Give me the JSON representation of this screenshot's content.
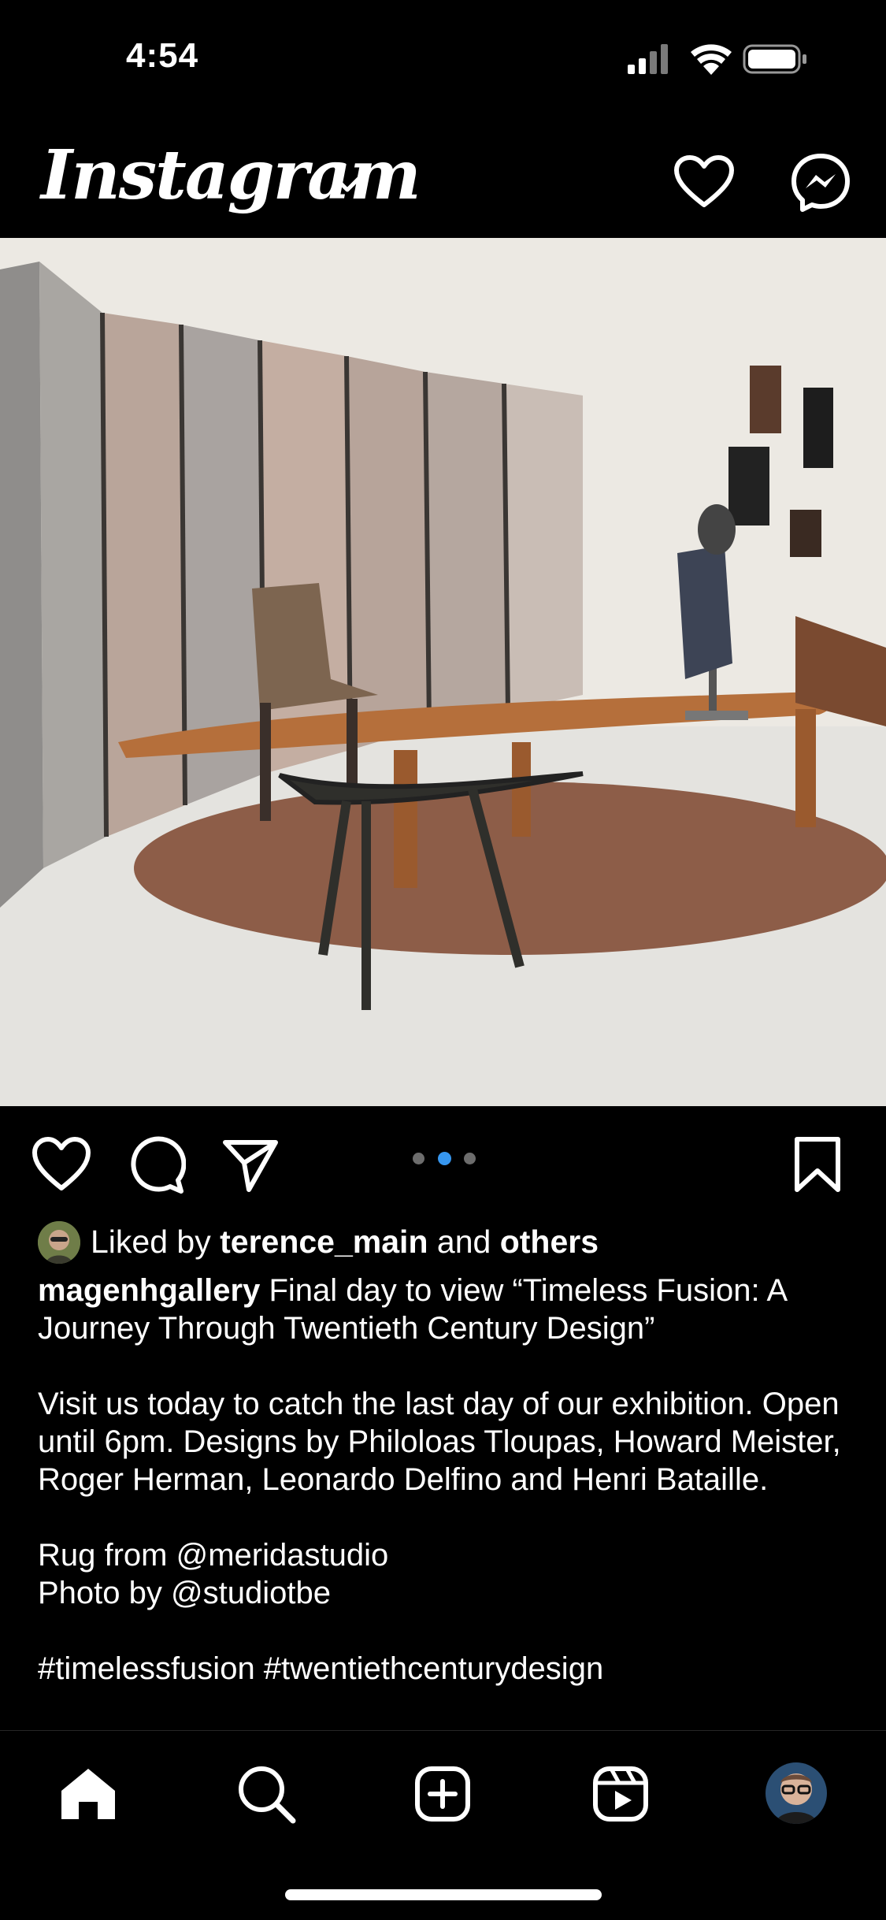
{
  "status_bar": {
    "time": "4:54"
  },
  "header": {
    "logo_text": "Instagram"
  },
  "post": {
    "image_alt": "Exhibition room with metal folding screen, wooden table, fur chair, stool and rug",
    "carousel": {
      "count": 3,
      "active_index": 1
    },
    "likes": {
      "prefix": "Liked by",
      "user": "terence_main",
      "connector": "and",
      "others": "others"
    },
    "caption": {
      "username": "magenhgallery",
      "text": " Final day to view “Timeless Fusion: A Journey Through Twentieth Century Design”\n\nVisit us today to catch the last day of our exhibition. Open until 6pm. Designs by Philoloas Tloupas, Howard Meister, Roger Herman, Leonardo Delfino and Henri Bataille.\n\nRug from @meridastudio\nPhoto by @studiotbe\n\n#timelessfusion #twentiethcenturydesign"
    }
  },
  "colors": {
    "active_dot": "#3797f0",
    "inactive_dot": "#6d6d6d",
    "background": "#000000"
  },
  "nav": {
    "items": [
      "home-icon",
      "search-icon",
      "create-icon",
      "reels-icon",
      "profile-avatar"
    ]
  }
}
